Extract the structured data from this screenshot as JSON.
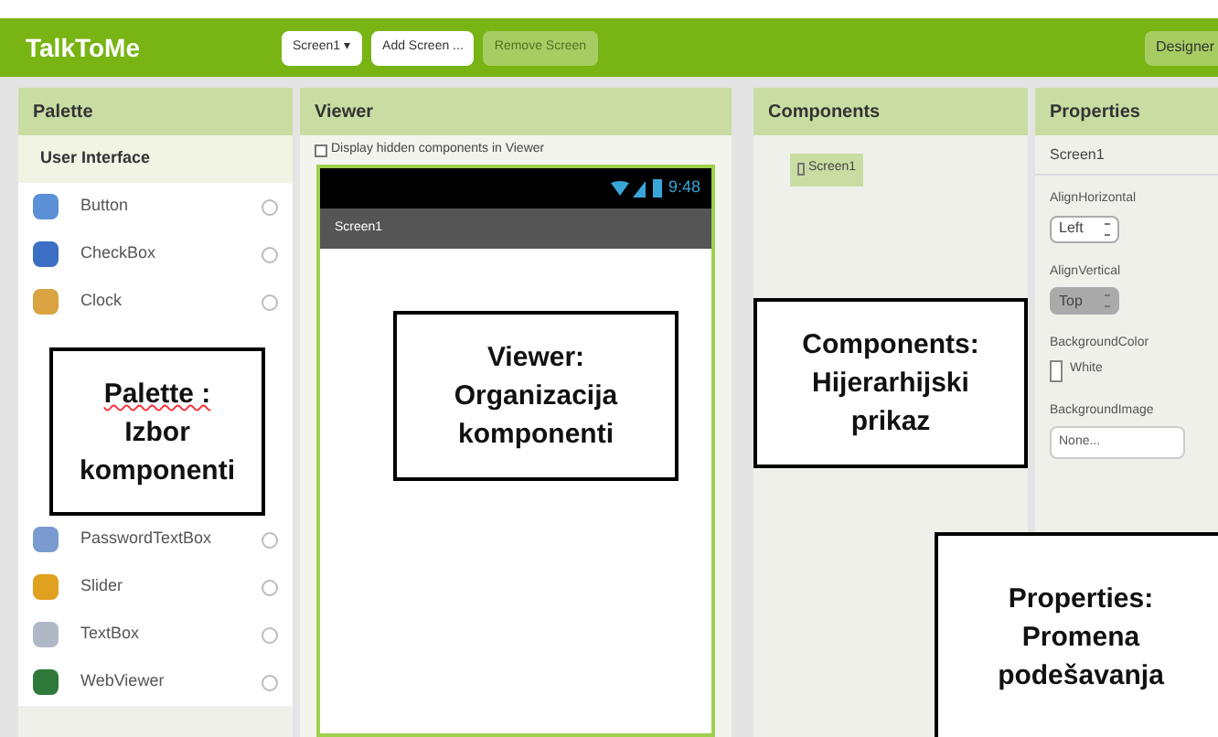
{
  "app_title": "TalkToMe",
  "toolbar": [
    {
      "label": "Screen1 ▾",
      "disabled": false
    },
    {
      "label": "Add Screen ...",
      "disabled": false
    },
    {
      "label": "Remove Screen",
      "disabled": true
    }
  ],
  "designer_button": "Designer",
  "palette": {
    "title": "Palette",
    "section": "User Interface",
    "items_top": [
      "Button",
      "CheckBox",
      "Clock"
    ],
    "items_bottom": [
      "PasswordTextBox",
      "Slider",
      "TextBox",
      "WebViewer"
    ]
  },
  "viewer": {
    "title": "Viewer",
    "hidden_checkbox": {
      "label": "Display hidden components in Viewer",
      "checked": false
    },
    "time": "9:48",
    "screen_title": "Screen1"
  },
  "components": {
    "title": "Components",
    "items": [
      {
        "label": "Screen1",
        "selected": true
      }
    ]
  },
  "properties": {
    "title": "Properties",
    "component": "Screen1",
    "align_horizontal": {
      "label": "AlignHorizontal",
      "value": "Left"
    },
    "align_vertical": {
      "label": "AlignVertical",
      "value": "Top"
    },
    "background_color": {
      "label": "BackgroundColor",
      "value": "White"
    },
    "background_image": {
      "label": "BackgroundImage",
      "value": "None..."
    }
  },
  "callouts": [
    {
      "kind": "palette",
      "lines": [
        "Palette :",
        "Izbor",
        "komponenti"
      ]
    },
    {
      "kind": "viewer",
      "lines": [
        "Viewer:",
        "Organizacija",
        "komponenti"
      ]
    },
    {
      "kind": "components",
      "lines": [
        "Components:",
        "Hijerarhijski",
        "prikaz"
      ]
    },
    {
      "kind": "properties",
      "lines": [
        "Properties:",
        "Promena",
        "podešavanja"
      ]
    }
  ]
}
